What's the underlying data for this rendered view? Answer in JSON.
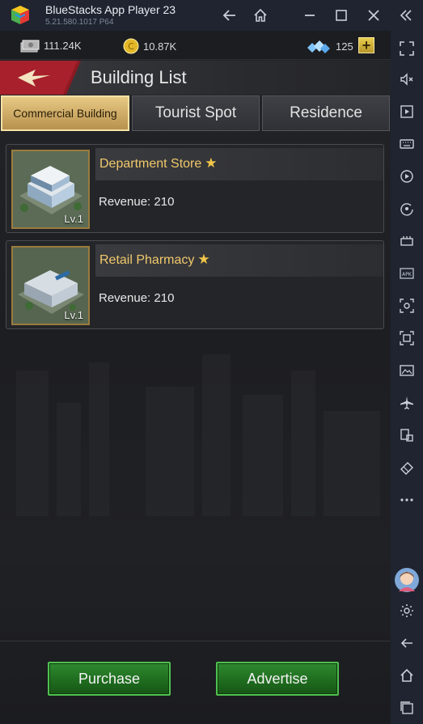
{
  "window": {
    "app_title": "BlueStacks App Player 23",
    "version": "5.21.580.1017  P64"
  },
  "resources": {
    "cash": "111.24K",
    "coins": "10.87K",
    "diamonds": "125"
  },
  "header": {
    "title": "Building List"
  },
  "tabs": [
    {
      "label": "Commercial Building",
      "active": true
    },
    {
      "label": "Tourist Spot",
      "active": false
    },
    {
      "label": "Residence",
      "active": false
    }
  ],
  "buildings": [
    {
      "name": "Department Store",
      "level": "Lv.1",
      "revenue": "Revenue: 210"
    },
    {
      "name": "Retail Pharmacy",
      "level": "Lv.1",
      "revenue": "Revenue: 210"
    }
  ],
  "footer": {
    "purchase_label": "Purchase",
    "advertise_label": "Advertise"
  },
  "colors": {
    "accent_gold": "#e7ca84",
    "button_green": "#2f8a2f",
    "titlebar": "#1f2430"
  }
}
